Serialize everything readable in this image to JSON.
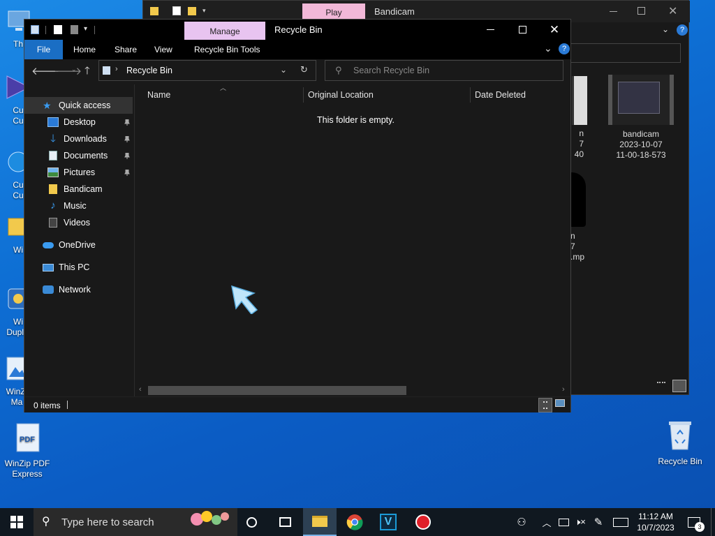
{
  "desktop": {
    "icons_left": [
      {
        "label": "Th"
      },
      {
        "label": "Cu\nCu"
      },
      {
        "label": "Cu\nCu"
      },
      {
        "label": "Wi"
      },
      {
        "label": "Wi\nDuplic"
      },
      {
        "label": "WinZi\nMa"
      },
      {
        "label": "WinZip PDF\nExpress"
      }
    ],
    "recycle_bin_label": "Recycle Bin"
  },
  "bg_window": {
    "title": "Bandicam",
    "context_tab": "Play",
    "files": [
      {
        "name": "bandicam",
        "line2": "2023-10-07",
        "line3": "11-00-18-573"
      }
    ],
    "partial_texts": [
      "n",
      "7",
      "40",
      "n",
      "7",
      ").mp"
    ]
  },
  "window": {
    "title": "Recycle Bin",
    "context_tab": "Manage",
    "ribbon_tabs": [
      "File",
      "Home",
      "Share",
      "View",
      "Recycle Bin Tools"
    ],
    "address": "Recycle Bin",
    "search_placeholder": "Search Recycle Bin",
    "nav": {
      "quick_access": "Quick access",
      "items": [
        {
          "label": "Desktop",
          "icon": "desktop-icon",
          "pinned": true
        },
        {
          "label": "Downloads",
          "icon": "download-icon",
          "pinned": true
        },
        {
          "label": "Documents",
          "icon": "documents-icon",
          "pinned": true
        },
        {
          "label": "Pictures",
          "icon": "pictures-icon",
          "pinned": true
        },
        {
          "label": "Bandicam",
          "icon": "folder-icon",
          "pinned": false
        },
        {
          "label": "Music",
          "icon": "music-icon",
          "pinned": false
        },
        {
          "label": "Videos",
          "icon": "videos-icon",
          "pinned": false
        }
      ],
      "onedrive": "OneDrive",
      "this_pc": "This PC",
      "network": "Network"
    },
    "columns": [
      "Name",
      "Original Location",
      "Date Deleted"
    ],
    "empty_message": "This folder is empty.",
    "status": "0 items"
  },
  "taskbar": {
    "search_placeholder": "Type here to search",
    "time": "11:12 AM",
    "date": "10/7/2023",
    "notification_count": "3"
  },
  "colors": {
    "desktop": "#0e6fd4",
    "window_bg": "#191919",
    "file_tab": "#1a6ec4",
    "manage_tab": "#e8c4f0",
    "play_tab": "#f2b8d8",
    "taskbar": "#101820"
  }
}
